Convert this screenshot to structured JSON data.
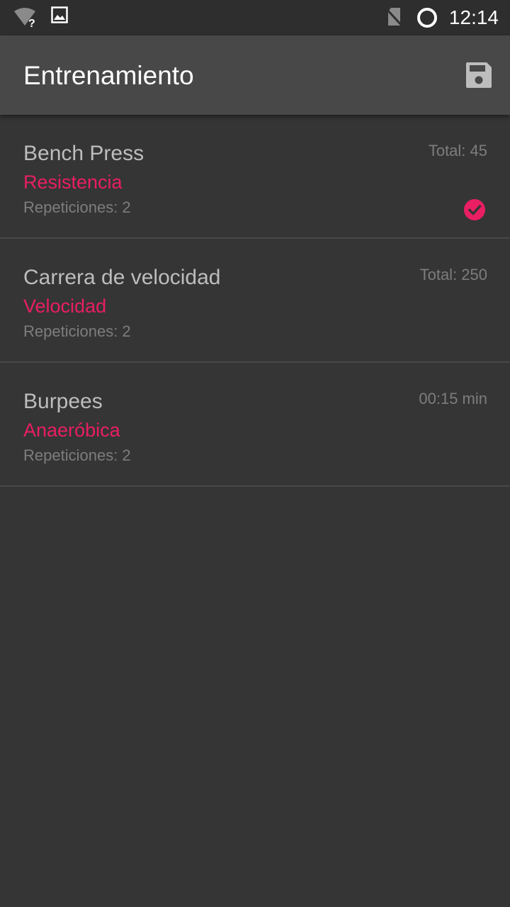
{
  "status_bar": {
    "time": "12:14",
    "icons": [
      "wifi-unknown-icon",
      "image-icon",
      "no-sim-icon",
      "sync-ring-icon"
    ]
  },
  "app_bar": {
    "title": "Entrenamiento",
    "action_icon": "save-icon"
  },
  "exercises": [
    {
      "name": "Bench Press",
      "category": "Resistencia",
      "reps": "Repeticiones: 2",
      "total": "Total: 45",
      "completed": true
    },
    {
      "name": "Carrera de velocidad",
      "category": "Velocidad",
      "reps": "Repeticiones: 2",
      "total": "Total: 250",
      "completed": false
    },
    {
      "name": "Burpees",
      "category": "Anaeróbica",
      "reps": "Repeticiones: 2",
      "total": "00:15 min",
      "completed": false
    }
  ],
  "colors": {
    "accent": "#e91e63",
    "background": "#353535",
    "app_bar": "#484848",
    "status_bar": "#2e2e2e"
  }
}
